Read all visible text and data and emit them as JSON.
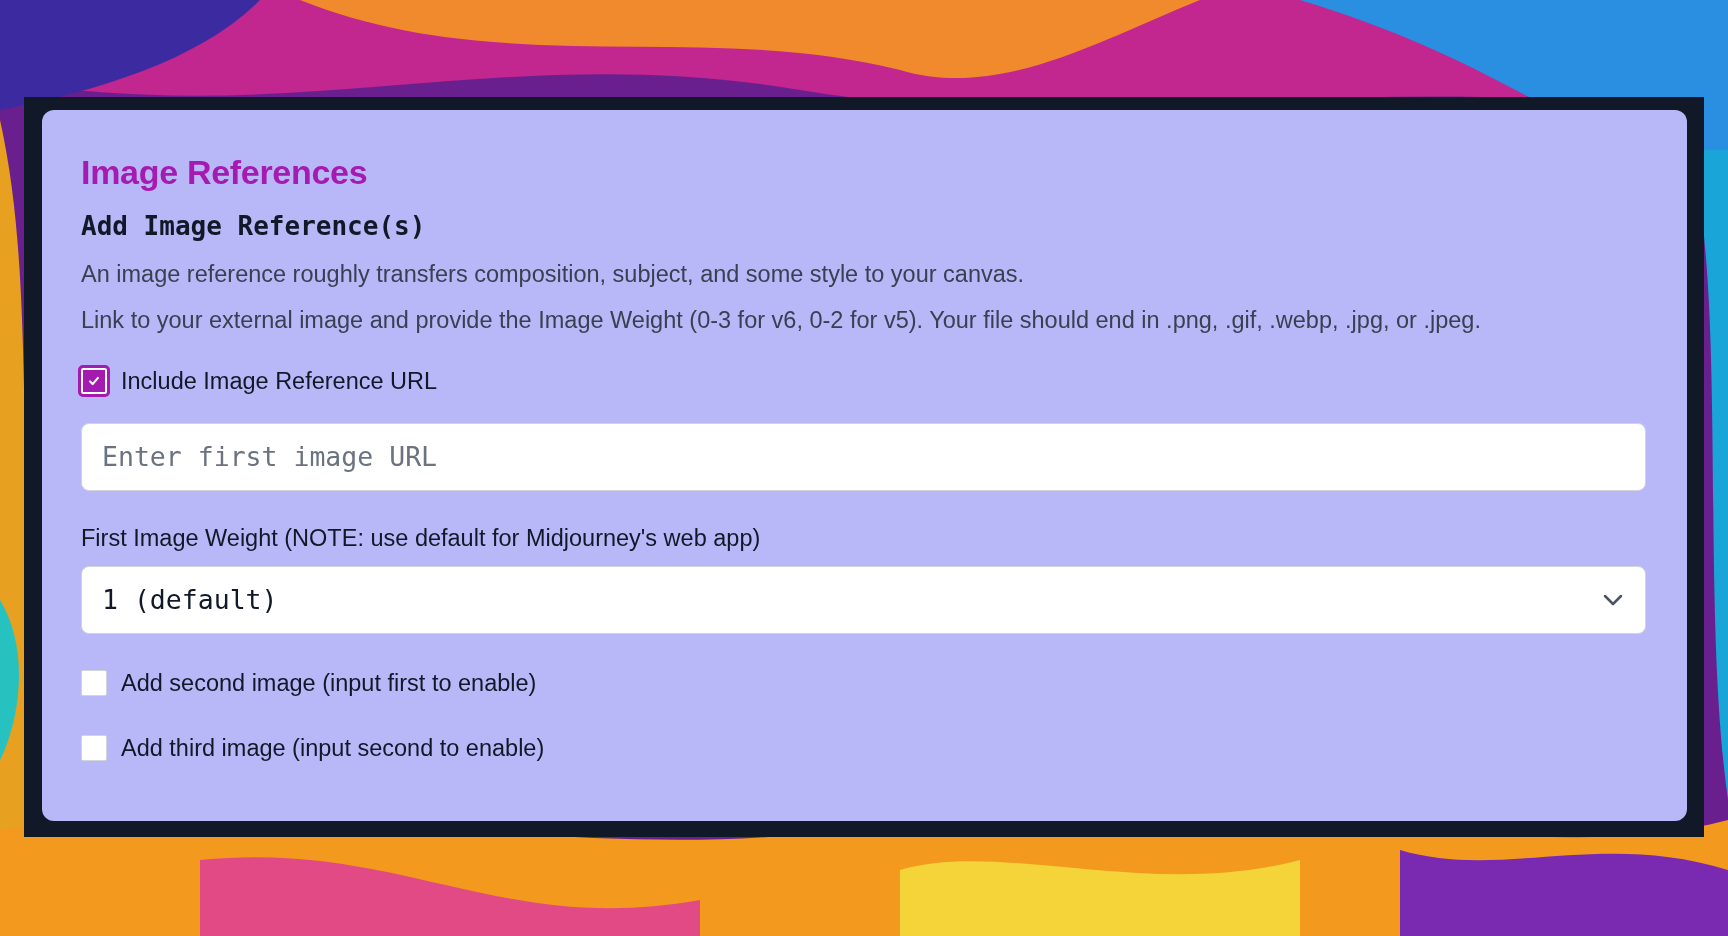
{
  "panel": {
    "title": "Image References",
    "subtitle": "Add Image Reference(s)",
    "descriptions": [
      "An image reference roughly transfers composition, subject, and some style to your canvas.",
      "Link to your external image and provide the Image Weight (0-3 for v6, 0-2 for v5). Your file should end in .png, .gif, .webp, .jpg, or .jpeg."
    ],
    "include_checkbox": {
      "label": "Include Image Reference URL",
      "checked": true
    },
    "url_field": {
      "placeholder": "Enter first image URL"
    },
    "weight_label": "First Image Weight (NOTE: use default for Midjourney's web app)",
    "weight_select": {
      "value": "1 (default)"
    },
    "extra_images": [
      {
        "label": "Add second image (input first to enable)",
        "checked": false
      },
      {
        "label": "Add third image (input second to enable)",
        "checked": false
      }
    ]
  }
}
